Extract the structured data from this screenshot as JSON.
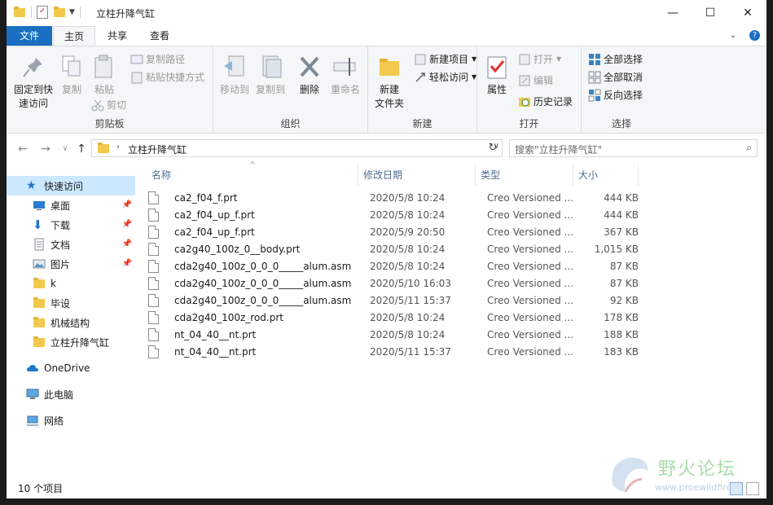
{
  "window": {
    "title": "立柱升降气缸",
    "minimize_glyph": "—",
    "maximize_glyph": "☐",
    "close_glyph": "✕"
  },
  "tabs": [
    "文件",
    "主页",
    "共享",
    "查看"
  ],
  "ribbon": {
    "clipboard": {
      "label": "剪贴板",
      "pin": "固定到快\n速访问",
      "pin_line1": "固定到快",
      "pin_line2": "速访问",
      "copy": "复制",
      "paste": "粘贴",
      "copy_path": "复制路径",
      "paste_shortcut": "粘贴快捷方式",
      "cut": "剪切"
    },
    "organize": {
      "label": "组织",
      "move_to": "移动到",
      "copy_to": "复制到",
      "delete": "删除",
      "rename": "重命名"
    },
    "new": {
      "label": "新建",
      "new_folder_line1": "新建",
      "new_folder_line2": "文件夹",
      "new_item": "新建项目",
      "easy_access": "轻松访问"
    },
    "open": {
      "label": "打开",
      "properties": "属性",
      "open": "打开",
      "edit": "编辑",
      "history": "历史记录"
    },
    "select": {
      "label": "选择",
      "select_all": "全部选择",
      "select_none": "全部取消",
      "invert": "反向选择"
    }
  },
  "address": {
    "path": "立柱升降气缸",
    "search_placeholder": "搜索\"立柱升降气缸\""
  },
  "nav": {
    "quick_access": "快速访问",
    "items": [
      "桌面",
      "下载",
      "文档",
      "图片",
      "k",
      "毕设",
      "机械结构",
      "立柱升降气缸"
    ],
    "onedrive": "OneDrive",
    "this_pc": "此电脑",
    "network": "网络"
  },
  "columns": [
    "名称",
    "修改日期",
    "类型",
    "大小"
  ],
  "files": [
    {
      "name": "ca2_f04_f.prt",
      "date": "2020/5/8 10:24",
      "type": "Creo Versioned ...",
      "size": "444 KB"
    },
    {
      "name": "ca2_f04_up_f.prt",
      "date": "2020/5/8 10:24",
      "type": "Creo Versioned ...",
      "size": "444 KB"
    },
    {
      "name": "ca2_f04_up_f.prt",
      "date": "2020/5/9 20:50",
      "type": "Creo Versioned ...",
      "size": "367 KB"
    },
    {
      "name": "ca2g40_100z_0__body.prt",
      "date": "2020/5/8 10:24",
      "type": "Creo Versioned ...",
      "size": "1,015 KB"
    },
    {
      "name": "cda2g40_100z_0_0_0_____alum.asm",
      "date": "2020/5/8 10:24",
      "type": "Creo Versioned ...",
      "size": "87 KB"
    },
    {
      "name": "cda2g40_100z_0_0_0_____alum.asm",
      "date": "2020/5/10 16:03",
      "type": "Creo Versioned ...",
      "size": "87 KB"
    },
    {
      "name": "cda2g40_100z_0_0_0_____alum.asm",
      "date": "2020/5/11 15:37",
      "type": "Creo Versioned ...",
      "size": "92 KB"
    },
    {
      "name": "cda2g40_100z_rod.prt",
      "date": "2020/5/8 10:24",
      "type": "Creo Versioned ...",
      "size": "178 KB"
    },
    {
      "name": "nt_04_40__nt.prt",
      "date": "2020/5/8 10:24",
      "type": "Creo Versioned ...",
      "size": "188 KB"
    },
    {
      "name": "nt_04_40__nt.prt",
      "date": "2020/5/11 15:37",
      "type": "Creo Versioned ...",
      "size": "183 KB"
    }
  ],
  "status": {
    "count": "10 个项目"
  },
  "watermark": {
    "text": "野火论坛",
    "url": "www.proewildfire"
  },
  "colors": {
    "accent": "#1a6fc2",
    "selection": "#cce8ff",
    "folder": "#f2c94c",
    "header_text": "#4d6d91"
  }
}
